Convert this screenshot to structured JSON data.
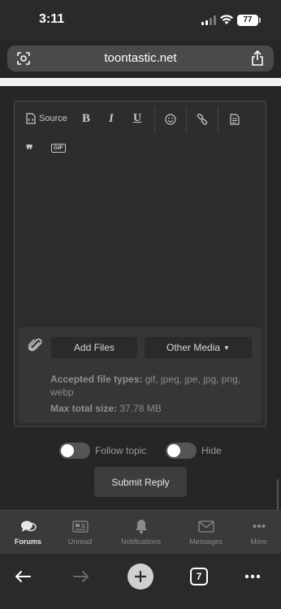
{
  "status": {
    "time": "3:11",
    "battery": "77"
  },
  "browser": {
    "url": "toontastic.net",
    "tab_count": "7"
  },
  "editor": {
    "toolbar": {
      "source_label": "Source",
      "bold_label": "B",
      "italic_label": "I",
      "underline_label": "U",
      "gif_label": "GIF"
    },
    "attachments": {
      "add_files_label": "Add Files",
      "other_media_label": "Other Media",
      "accepted_label": "Accepted file types:",
      "accepted_types": "gif, jpeg, jpe, jpg, png, webp",
      "max_size_label": "Max total size:",
      "max_size_value": "37.78 MB"
    }
  },
  "options": {
    "follow_topic_label": "Follow topic",
    "hide_label": "Hide"
  },
  "submit_label": "Submit Reply",
  "bottom_nav": {
    "items": [
      {
        "label": "Forums",
        "icon": "chat-bubbles-icon"
      },
      {
        "label": "Unread",
        "icon": "newspaper-icon"
      },
      {
        "label": "Notifications",
        "icon": "bell-icon"
      },
      {
        "label": "Messages",
        "icon": "envelope-icon"
      },
      {
        "label": "More",
        "icon": "ellipsis-icon"
      }
    ]
  }
}
